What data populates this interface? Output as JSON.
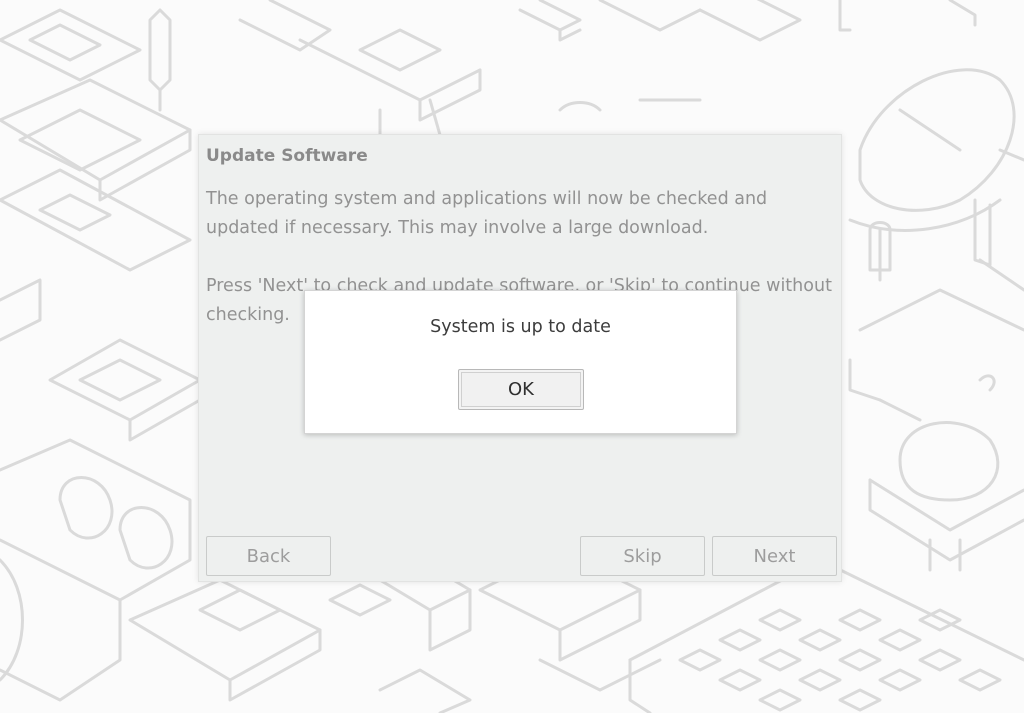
{
  "wizard": {
    "title": "Update Software",
    "paragraph1": "The operating system and applications will now be checked and updated if necessary. This may involve a large download.",
    "paragraph2": "Press 'Next' to check and update software, or 'Skip' to continue without checking.",
    "back_label": "Back",
    "skip_label": "Skip",
    "next_label": "Next"
  },
  "dialog": {
    "message": "System is up to date",
    "ok_label": "OK"
  },
  "colors": {
    "wallpaper_bg": "#fbfbfb",
    "wallpaper_lines": "#dadada",
    "wizard_bg": "#eef0ef",
    "dialog_bg": "#ffffff"
  }
}
